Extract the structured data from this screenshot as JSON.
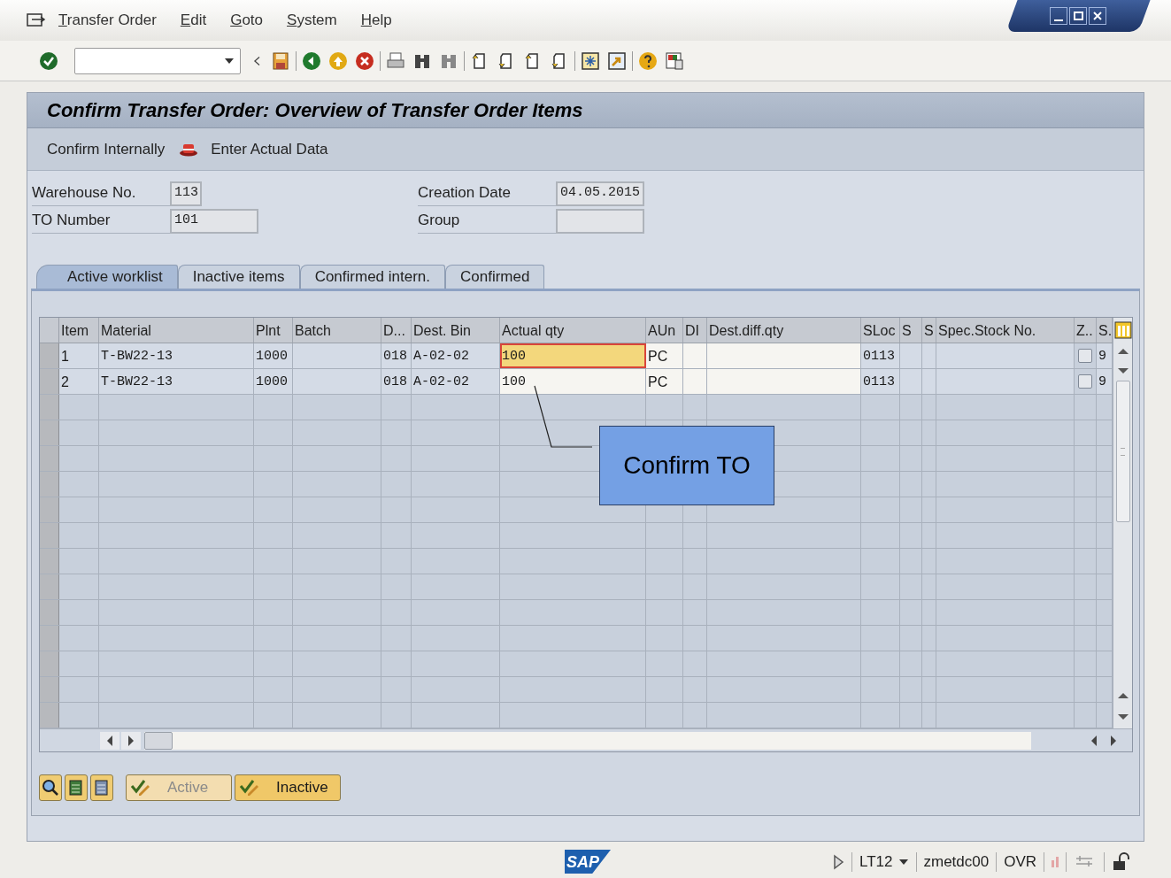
{
  "menu_bar": {
    "items": [
      "Transfer Order",
      "Edit",
      "Goto",
      "System",
      "Help"
    ]
  },
  "screen": {
    "title": "Confirm Transfer Order: Overview of Transfer Order Items",
    "app_toolbar": [
      {
        "label": "Confirm Internally",
        "kind": "text"
      },
      {
        "label": "Enter Actual Data",
        "kind": "icon"
      }
    ]
  },
  "header_fields": [
    {
      "label": "Warehouse No.",
      "value": "113"
    },
    {
      "label": "Creation Date",
      "value": "04.05.2015"
    },
    {
      "label": "TO Number",
      "value": "101"
    },
    {
      "label": "Group"
    }
  ],
  "tabs": [
    {
      "label": "Active worklist",
      "selected": true
    },
    {
      "label": "Inactive items",
      "selected": false
    },
    {
      "label": "Confirmed intern.",
      "selected": false
    },
    {
      "label": "Confirmed",
      "selected": false
    }
  ],
  "table": {
    "columns": [
      {
        "label": "Item"
      },
      {
        "label": "Material"
      },
      {
        "label": "Plnt"
      },
      {
        "label": "Batch"
      },
      {
        "label": "D..."
      },
      {
        "label": "Dest. Bin"
      },
      {
        "label": "Actual qty"
      },
      {
        "label": "AUn"
      },
      {
        "label": "DI"
      },
      {
        "label": "Dest.diff.qty"
      },
      {
        "label": "SLoc"
      },
      {
        "label": "S"
      },
      {
        "label": "S"
      },
      {
        "label": "Spec.Stock No."
      },
      {
        "label": "Z.."
      },
      {
        "label": "S."
      }
    ],
    "rows": [
      {
        "cells": [
          "1",
          "T-BW22-13",
          "1000",
          null,
          "018",
          "A-02-02",
          "100",
          "PC",
          null,
          null,
          "0113",
          null,
          null,
          null,
          null,
          "9"
        ],
        "checked": false,
        "focused": true
      },
      {
        "cells": [
          "2",
          "T-BW22-13",
          "1000",
          null,
          "018",
          "A-02-02",
          "100",
          "PC",
          null,
          null,
          "0113",
          null,
          null,
          null,
          null,
          "9"
        ],
        "checked": false,
        "focused": false
      }
    ]
  },
  "callout": {
    "text": "Confirm TO"
  },
  "buttons": [
    {
      "label": "Active",
      "disabled": true
    },
    {
      "label": "Inactive",
      "disabled": false
    }
  ],
  "status_bar": {
    "logo": "SAP",
    "transaction": "LT12",
    "server": "zmetdc00",
    "mode": "OVR"
  }
}
